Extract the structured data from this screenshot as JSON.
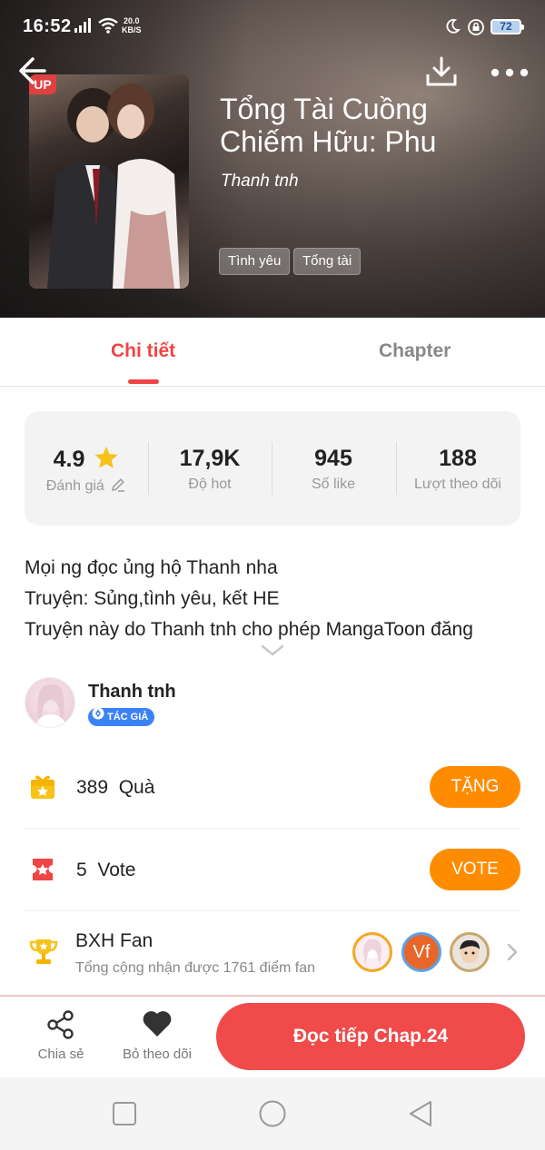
{
  "status_bar": {
    "time": "16:52",
    "net_speed_value": "20.0",
    "net_speed_unit": "KB/S",
    "battery": "72"
  },
  "book": {
    "cover_badge": "UP",
    "title": "Tổng Tài Cuồng Chiếm Hữu: Phu",
    "author": "Thanh tnh",
    "tags": [
      "Tình yêu",
      "Tổng tài"
    ]
  },
  "tabs": {
    "detail": "Chi tiết",
    "chapter": "Chapter"
  },
  "stats": [
    {
      "value": "4.9",
      "label": "Đánh giá"
    },
    {
      "value": "17,9K",
      "label": "Độ hot"
    },
    {
      "value": "945",
      "label": "Số like"
    },
    {
      "value": "188",
      "label": "Lượt theo dõi"
    }
  ],
  "description": [
    "Mọi ng đọc ủng hộ Thanh nha",
    "Truyện: Sủng,tình yêu, kết HE",
    "Truyện này do Thanh tnh cho phép MangaToon đăng"
  ],
  "author_box": {
    "name": "Thanh tnh",
    "badge": "TÁC GIẢ"
  },
  "gift": {
    "count": "389",
    "label": "Quà",
    "button": "TẶNG"
  },
  "vote": {
    "count": "5",
    "label": "Vote",
    "button": "VOTE"
  },
  "fan_ranking": {
    "title": "BXH Fan",
    "subtitle": "Tổng cộng nhận được 1761 điểm fan",
    "fans": [
      "",
      "Vf",
      ""
    ]
  },
  "bottom_bar": {
    "share": "Chia sẻ",
    "unfollow": "Bỏ theo dõi",
    "read_button": "Đọc tiếp Chap.24"
  },
  "colors": {
    "accent": "#ef4444",
    "orange": "#ff8c00",
    "star": "#f7c21a"
  }
}
